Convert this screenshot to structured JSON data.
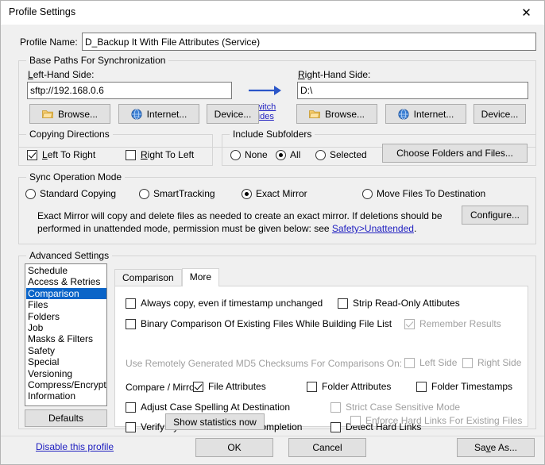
{
  "window": {
    "title": "Profile Settings",
    "close_icon": "close-icon"
  },
  "profile": {
    "name_label": "Profile Name:",
    "name_value": "D_Backup It With File Attributes (Service)"
  },
  "base_paths": {
    "legend": "Base Paths For Synchronization",
    "left_label": "Left-Hand Side:",
    "left_value": "sftp://192.168.0.6",
    "right_label": "Right-Hand Side:",
    "right_value": "D:\\",
    "arrow_icon": "arrow-right-icon",
    "switch_line1": "switch",
    "switch_line2": "sides",
    "left_buttons": [
      {
        "label": "Browse...",
        "icon": "folder-icon"
      },
      {
        "label": "Internet...",
        "icon": "globe-icon"
      },
      {
        "label": "Device...",
        "icon": "none"
      }
    ],
    "right_buttons": [
      {
        "label": "Browse...",
        "icon": "folder-icon"
      },
      {
        "label": "Internet...",
        "icon": "globe-icon"
      },
      {
        "label": "Device...",
        "icon": "none"
      }
    ]
  },
  "copying_directions": {
    "legend": "Copying Directions",
    "left_to_right": {
      "label": "Left To Right",
      "checked": true
    },
    "right_to_left": {
      "label": "Right To Left",
      "checked": false
    }
  },
  "include_subfolders": {
    "legend": "Include Subfolders",
    "options": [
      {
        "label": "None",
        "selected": false
      },
      {
        "label": "All",
        "selected": true
      },
      {
        "label": "Selected",
        "selected": false
      }
    ],
    "choose_button": "Choose Folders and Files..."
  },
  "sync_mode": {
    "legend": "Sync Operation Mode",
    "options": [
      {
        "label": "Standard Copying",
        "selected": false
      },
      {
        "label": "SmartTracking",
        "selected": false
      },
      {
        "label": "Exact Mirror",
        "selected": true
      },
      {
        "label": "Move Files To Destination",
        "selected": false
      }
    ],
    "description_part1": "Exact Mirror will copy and delete files as needed to create an exact mirror. If deletions should be performed in unattended mode, permission must be given below: see ",
    "description_link": "Safety>Unattended",
    "description_part2": ".",
    "configure_button": "Configure..."
  },
  "advanced": {
    "legend": "Advanced Settings",
    "list_items": [
      {
        "label": "Schedule",
        "selected": false
      },
      {
        "label": "Access & Retries",
        "selected": false
      },
      {
        "label": "Comparison",
        "selected": true
      },
      {
        "label": "Files",
        "selected": false
      },
      {
        "label": "Folders",
        "selected": false
      },
      {
        "label": "Job",
        "selected": false
      },
      {
        "label": "Masks & Filters",
        "selected": false
      },
      {
        "label": "Safety",
        "selected": false
      },
      {
        "label": "Special",
        "selected": false
      },
      {
        "label": "Versioning",
        "selected": false
      },
      {
        "label": "Compress/Encrypt",
        "selected": false
      },
      {
        "label": "Information",
        "selected": false
      }
    ],
    "defaults_button": "Defaults",
    "tabs": [
      {
        "label": "Comparison",
        "active": false
      },
      {
        "label": "More",
        "active": true
      }
    ],
    "options": {
      "always_copy": {
        "label": "Always copy, even if timestamp unchanged",
        "checked": false,
        "disabled": false
      },
      "strip_readonly": {
        "label": "Strip Read-Only Attibutes",
        "checked": false,
        "disabled": false
      },
      "binary_comparison": {
        "label": "Binary Comparison Of Existing Files While Building File List",
        "checked": false,
        "disabled": false
      },
      "remember_results": {
        "label": "Remember Results",
        "checked": true,
        "disabled": true
      },
      "md5_label": "Use Remotely Generated MD5 Checksums For Comparisons On:",
      "md5_left": {
        "label": "Left Side",
        "checked": false,
        "disabled": true
      },
      "md5_right": {
        "label": "Right Side",
        "checked": false,
        "disabled": true
      },
      "compare_mirror_label": "Compare / Mirror:",
      "file_attributes": {
        "label": "File Attributes",
        "checked": true,
        "disabled": false
      },
      "folder_attributes": {
        "label": "Folder Attributes",
        "checked": false,
        "disabled": false
      },
      "folder_timestamps": {
        "label": "Folder Timestamps",
        "checked": false,
        "disabled": false
      },
      "adjust_case": {
        "label": "Adjust Case Spelling At Destination",
        "checked": false,
        "disabled": false
      },
      "strict_case": {
        "label": "Strict Case Sensitive Mode",
        "checked": false,
        "disabled": true
      },
      "verify_sync": {
        "label": "Verify Sync Statistics After Completion",
        "checked": false,
        "disabled": false
      },
      "detect_hard_links": {
        "label": "Detect Hard Links",
        "checked": false,
        "disabled": false
      },
      "enforce_hard_links": {
        "label": "Enforce Hard Links For Existing Files",
        "checked": false,
        "disabled": true
      },
      "show_statistics_button": "Show statistics now"
    }
  },
  "footer": {
    "disable_link": "Disable this profile",
    "ok_button": "OK",
    "cancel_button": "Cancel",
    "save_as_button": "Save As..."
  },
  "colors": {
    "accent_blue": "#0a64c8",
    "link_blue": "#2020c0",
    "arrow_blue": "#2b56c8",
    "dialog_bg": "#f0f0f0",
    "button_bg": "#e1e1e1"
  }
}
